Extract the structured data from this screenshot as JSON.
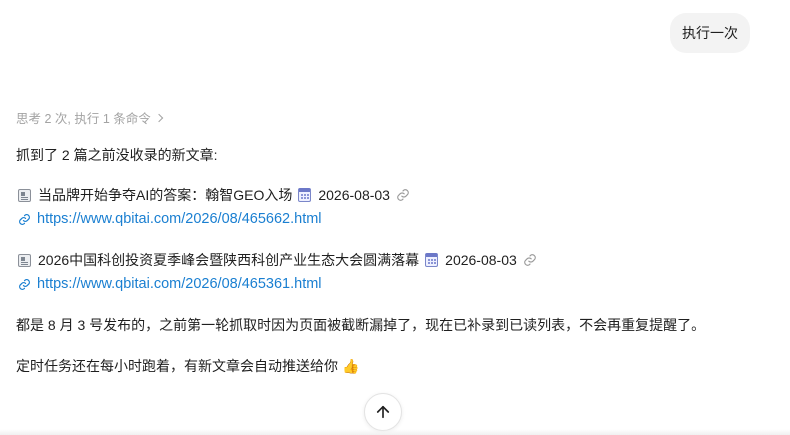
{
  "user_message": "执行一次",
  "thinking_summary": "思考 2 次, 执行 1 条命令",
  "intro": "抓到了 2 篇之前没收录的新文章:",
  "articles": [
    {
      "title": "当品牌开始争夺AI的答案：翰智GEO入场",
      "date": "2026-08-03",
      "url": "https://www.qbitai.com/2026/08/465662.html"
    },
    {
      "title": "2026中国科创投资夏季峰会暨陕西科创产业生态大会圆满落幕",
      "date": "2026-08-03",
      "url": "https://www.qbitai.com/2026/08/465361.html"
    }
  ],
  "note": "都是 8 月 3 号发布的，之前第一轮抓取时因为页面被截断漏掉了，现在已补录到已读列表，不会再重复提醒了。",
  "schedule": "定时任务还在每小时跑着，有新文章会自动推送给你",
  "icons": {
    "article": "newspaper-icon",
    "date": "calendar-icon",
    "link": "link-icon",
    "thumb": "thumbs-up-icon",
    "scroll": "arrow-up-icon"
  },
  "colors": {
    "link": "#1a7fd1",
    "bubble_bg": "#f3f3f3",
    "muted": "#a3a3a3"
  }
}
